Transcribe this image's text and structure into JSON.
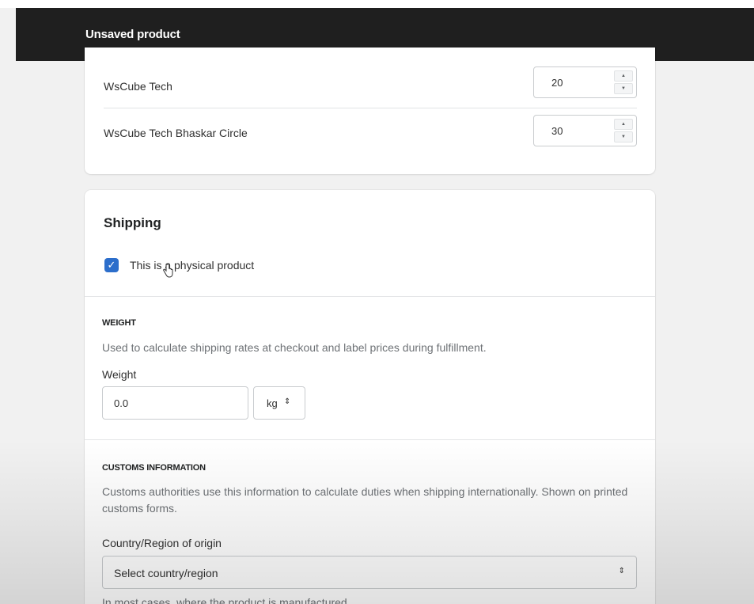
{
  "header": {
    "title": "Unsaved product"
  },
  "inventory": {
    "locations": [
      {
        "name": "WsCube Tech",
        "quantity": "20"
      },
      {
        "name": "WsCube Tech Bhaskar Circle",
        "quantity": "30"
      }
    ]
  },
  "shipping": {
    "title": "Shipping",
    "physical_product": {
      "label": "This is a physical product",
      "checked": true
    },
    "weight": {
      "heading": "WEIGHT",
      "help": "Used to calculate shipping rates at checkout and label prices during fulfillment.",
      "label": "Weight",
      "value": "0.0",
      "unit": "kg",
      "unit_arrow": "⇕"
    },
    "customs": {
      "heading": "CUSTOMS INFORMATION",
      "help": "Customs authorities use this information to calculate duties when shipping internationally. Shown on printed customs forms.",
      "country_label": "Country/Region of origin",
      "country_value": "Select country/region",
      "footnote": "In most cases, where the product is manufactured."
    }
  },
  "icons": {
    "check": "✓",
    "step_up": "▲",
    "step_down": "▼",
    "select_arrow": "⇕"
  },
  "colors": {
    "topbar": "#1f1f1f",
    "checkbox": "#2c6ecb",
    "background": "#f1f1f1"
  }
}
